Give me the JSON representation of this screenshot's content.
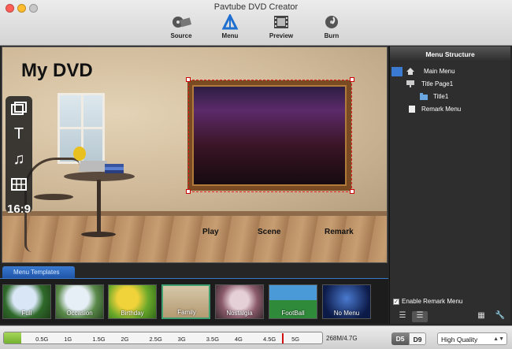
{
  "window": {
    "title": "Pavtube DVD Creator"
  },
  "toolbar": {
    "buttons": [
      {
        "label": "Source",
        "icon": "film-reel-icon"
      },
      {
        "label": "Menu",
        "icon": "menu-icon"
      },
      {
        "label": "Preview",
        "icon": "preview-film-icon"
      },
      {
        "label": "Burn",
        "icon": "burn-disc-icon"
      }
    ]
  },
  "canvas": {
    "dvd_title": "My DVD",
    "menu_items": [
      "Play",
      "Scene",
      "Remark"
    ]
  },
  "tools": {
    "text_icon": "T",
    "music_icon": "♫",
    "aspect_label": "16:9"
  },
  "menu_structure": {
    "title": "Menu Structure",
    "items": [
      {
        "label": "Main Menu",
        "icon": "home-icon"
      },
      {
        "label": "Title Page1",
        "icon": "monitor-icon"
      },
      {
        "label": "Title1",
        "icon": "folder-icon"
      },
      {
        "label": "Remark Menu",
        "icon": "document-icon"
      }
    ],
    "enable_remark_label": "Enable Remark Menu",
    "enable_remark_checked": true
  },
  "templates": {
    "tab_label": "Menu Templates",
    "items": [
      {
        "label": "Full"
      },
      {
        "label": "Occasion"
      },
      {
        "label": "Birthday"
      },
      {
        "label": "Family"
      },
      {
        "label": "Nostalgia"
      },
      {
        "label": "FootBall"
      },
      {
        "label": "No Menu"
      }
    ],
    "selected": "Family"
  },
  "status": {
    "ticks": [
      "0.5G",
      "1G",
      "1.5G",
      "2G",
      "2.5G",
      "3G",
      "3.5G",
      "4G",
      "4.5G",
      "5G"
    ],
    "usage_text": "268M/4.7G",
    "fill_fraction": 0.055,
    "capacity_marker_gb": 4.7,
    "disc_d5": "D5",
    "disc_d9": "D9",
    "selected_disc": "D5",
    "quality": "High Quality"
  },
  "colors": {
    "accent_blue": "#3a7ad0",
    "gauge_green": "#6cab2a",
    "marker_red": "#d01010"
  }
}
